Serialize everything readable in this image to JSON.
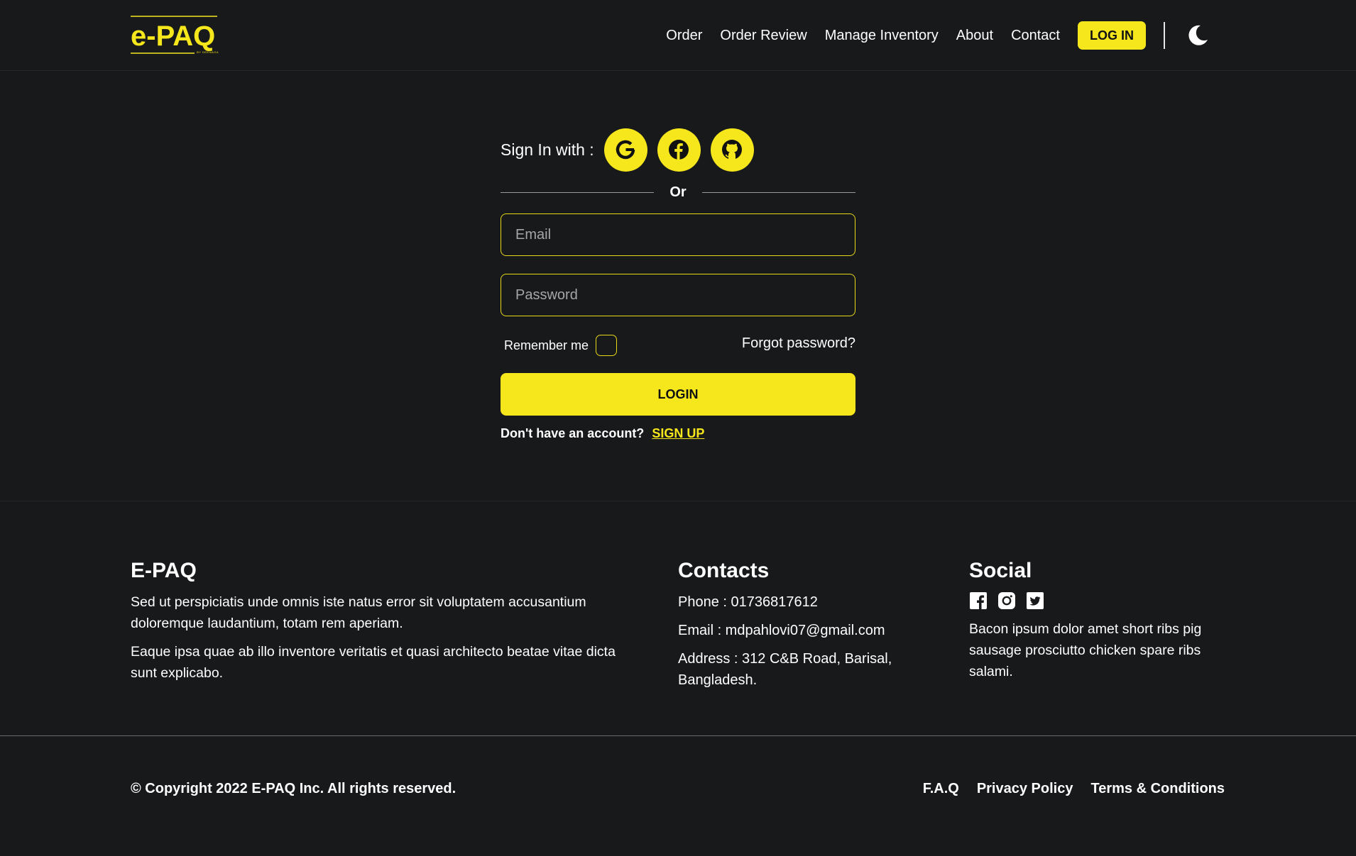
{
  "brand": {
    "logo_text": "e-PAQ",
    "logo_tagline": "BY DEENAGA",
    "accent_color": "#f5e71c",
    "background_color": "#17191b"
  },
  "nav": {
    "links": [
      "Order",
      "Order Review",
      "Manage Inventory",
      "About",
      "Contact"
    ],
    "login_label": "LOG IN",
    "theme_icon": "moon-icon"
  },
  "login": {
    "signin_label": "Sign In with :",
    "providers": [
      "google-icon",
      "facebook-icon",
      "github-icon"
    ],
    "or_label": "Or",
    "email_placeholder": "Email",
    "password_placeholder": "Password",
    "remember_label": "Remember me",
    "forgot_label": "Forgot password?",
    "submit_label": "LOGIN",
    "no_account_text": "Don't have an account?",
    "signup_label": "SIGN UP"
  },
  "footer": {
    "about": {
      "heading": "E-PAQ",
      "paragraph1": "Sed ut perspiciatis unde omnis iste natus error sit voluptatem accusantium doloremque laudantium, totam rem aperiam.",
      "paragraph2": "Eaque ipsa quae ab illo inventore veritatis et quasi architecto beatae vitae dicta sunt explicabo."
    },
    "contacts": {
      "heading": "Contacts",
      "phone": "Phone : 01736817612",
      "email": "Email : mdpahlovi07@gmail.com",
      "address": "Address : 312 C&B Road, Barisal, Bangladesh."
    },
    "social": {
      "heading": "Social",
      "icons": [
        "facebook-icon",
        "instagram-icon",
        "twitter-icon"
      ],
      "text": "Bacon ipsum dolor amet short ribs pig sausage prosciutto chicken spare ribs salami."
    },
    "copyright": "© Copyright 2022 E-PAQ Inc. All rights reserved.",
    "bottom_links": [
      "F.A.Q",
      "Privacy Policy",
      "Terms & Conditions"
    ]
  }
}
